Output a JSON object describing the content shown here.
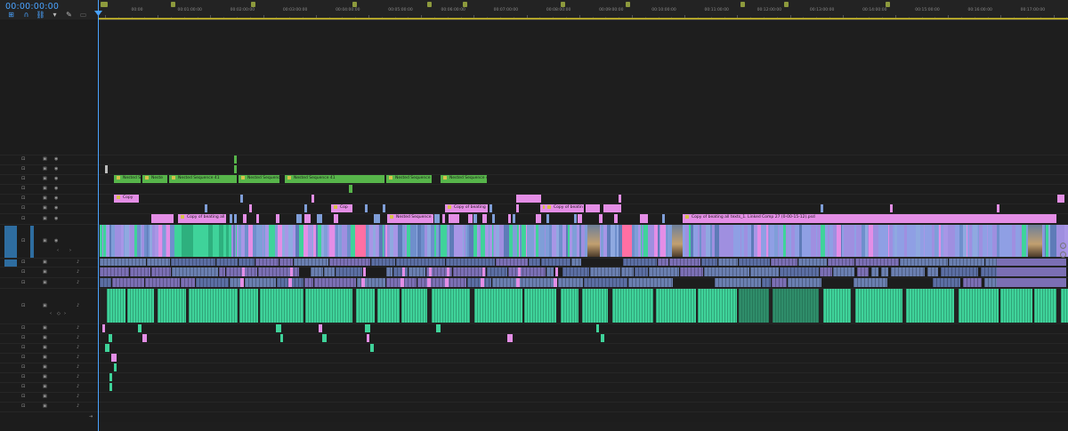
{
  "app": {
    "timecode": "00:00:00:00",
    "toolbar_icons": [
      "snap-icon",
      "linked-selection-icon",
      "markers-icon",
      "wrench-icon",
      "captions-icon"
    ]
  },
  "ruler": {
    "labels": [
      "00:00",
      "00:01:00:00",
      "00:02:00:00",
      "00:03:00:00",
      "00:04:00:00",
      "00:05:00:00",
      "00:06:00:00",
      "00:07:00:00",
      "00:08:00:00",
      "00:09:00:00",
      "00:10:00:00",
      "00:11:00:00",
      "00:12:00:00",
      "00:13:00:00",
      "00:14:00:00",
      "00:15:00:00",
      "00:16:00:00",
      "00:17:00:00",
      "00:18:00:00"
    ]
  },
  "tracks": {
    "video": [
      {
        "id": "V8",
        "label": "V8"
      },
      {
        "id": "V7",
        "label": "V7"
      },
      {
        "id": "V6",
        "label": "V6"
      },
      {
        "id": "V5",
        "label": "V5"
      },
      {
        "id": "V4",
        "label": "V4"
      },
      {
        "id": "V3",
        "label": "V3"
      },
      {
        "id": "V2",
        "label": "V2"
      },
      {
        "id": "V1",
        "label": "V1",
        "name": "Video 1",
        "source": "V1"
      }
    ],
    "audio": [
      {
        "id": "A1",
        "label": "A1",
        "source": "A1"
      },
      {
        "id": "A2",
        "label": "A2"
      },
      {
        "id": "A3",
        "label": "A3"
      },
      {
        "id": "A4",
        "label": "A4",
        "name": "Audio 4"
      },
      {
        "id": "A5",
        "label": "A5"
      },
      {
        "id": "A6",
        "label": "A6"
      },
      {
        "id": "A7",
        "label": "A7"
      },
      {
        "id": "A8",
        "label": "A8"
      },
      {
        "id": "A9",
        "label": "A9"
      },
      {
        "id": "A10",
        "label": "A10"
      },
      {
        "id": "A11",
        "label": "A11"
      },
      {
        "id": "A12",
        "label": "A12"
      },
      {
        "id": "A13",
        "label": "A13"
      }
    ],
    "mix": {
      "label": "Mix",
      "value": "0.0"
    },
    "toggle_m": "M",
    "toggle_s": "S"
  },
  "clip_labels": {
    "v6_1": "Nested S",
    "v6_2": "Neste",
    "v6_3": "Nested Sequence 41",
    "v6_4": "Nested Sequence",
    "v6_5": "Nested Sequence 41",
    "v6_6": "Nested Sequence 4",
    "v6_7": "Nested Sequence 41",
    "v4_1": "Copy",
    "v3_1": "Cop",
    "v3_2": "Copy of beating",
    "v3_3": "Copy o",
    "v3_4": "Copy of beatin",
    "v2_1": "Copy of beating all",
    "v2_2": "Nested Sequence 7",
    "v2_3": "Copy of beating all texts_1. Linked Comp 27 (0-00-15-12).psd"
  },
  "colors": {
    "playhead": "#4aa3ff",
    "nested_green": "#57b54a",
    "pink": "#e48ee6",
    "violet_video": "#9f8fe0",
    "blue_video": "#7f9ed8",
    "audio_teal": "#3fd39a",
    "audio_slate": "#6a7fb0",
    "work_area": "#b3a52a"
  }
}
